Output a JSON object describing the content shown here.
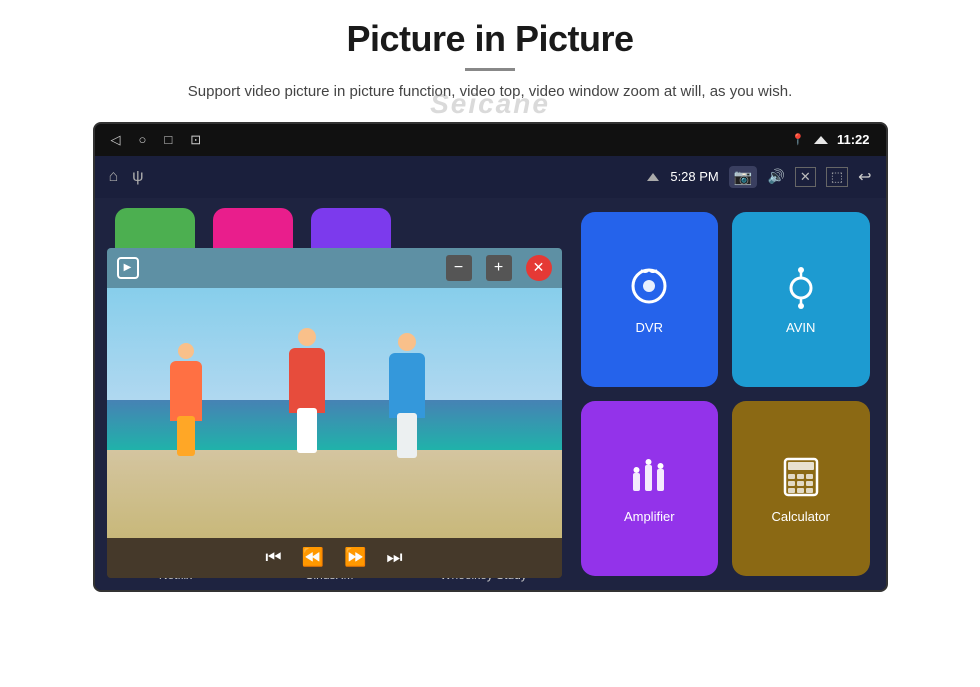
{
  "page": {
    "title": "Picture in Picture",
    "subtitle": "Support video picture in picture function, video top, video window zoom at will, as you wish.",
    "watermark": "Seicane"
  },
  "status_bar": {
    "time": "11:22",
    "nav_icons": [
      "◁",
      "○",
      "□",
      "⊡"
    ],
    "right_icons": [
      "📍",
      "▼"
    ]
  },
  "toolbar": {
    "left_icons": [
      "⌂",
      "ψ"
    ],
    "time": "5:28 PM",
    "right_icons": [
      "📷",
      "🔊",
      "✕",
      "⬚",
      "↩"
    ]
  },
  "pip_controls": {
    "minimize": "−",
    "expand": "+",
    "close": "✕"
  },
  "app_icons": {
    "dvr": {
      "label": "DVR",
      "color": "#2563eb"
    },
    "avin": {
      "label": "AVIN",
      "color": "#1d9bd1"
    },
    "amplifier": {
      "label": "Amplifier",
      "color": "#9333ea"
    },
    "calculator": {
      "label": "Calculator",
      "color": "#8B6914"
    }
  },
  "bottom_apps": {
    "netflix": {
      "label": "Netflix",
      "color": "#c0392b"
    },
    "siriusxm": {
      "label": "SiriusXM",
      "color": "#1565c0"
    },
    "wheelkey": {
      "label": "Wheelkey Study",
      "color": "#2e7d32"
    }
  }
}
